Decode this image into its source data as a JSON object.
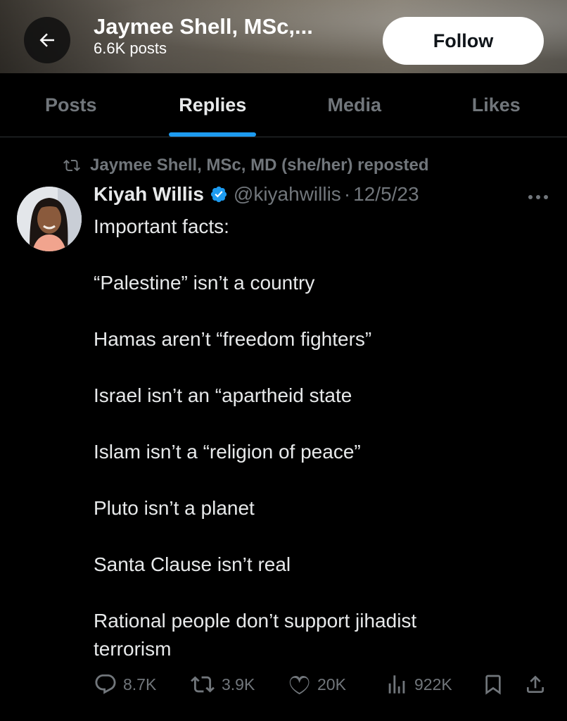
{
  "header": {
    "title": "Jaymee Shell, MSc,...",
    "subtitle": "6.6K posts",
    "follow_label": "Follow"
  },
  "tabs": [
    {
      "label": "Posts",
      "active": false
    },
    {
      "label": "Replies",
      "active": true
    },
    {
      "label": "Media",
      "active": false
    },
    {
      "label": "Likes",
      "active": false
    }
  ],
  "repost": {
    "text": "Jaymee Shell, MSc, MD (she/her) reposted",
    "icon": "repost-icon"
  },
  "tweet": {
    "author_name": "Kiyah Willis",
    "verified": true,
    "handle": "@kiyahwillis",
    "separator": "·",
    "date": "12/5/23",
    "paragraphs": [
      "Important facts:",
      "“Palestine” isn’t a country",
      "Hamas aren’t “freedom fighters”",
      "Israel isn’t an “apartheid state",
      "Islam isn’t a “religion of peace”",
      "Pluto isn’t a planet",
      "Santa Clause isn’t real",
      "Rational people don’t support jihadist terrorism"
    ],
    "stats": {
      "replies": "8.7K",
      "reposts": "3.9K",
      "likes": "20K",
      "views": "922K"
    }
  },
  "colors": {
    "accent": "#1d9bf0",
    "muted": "#71767b",
    "text": "#e7e9ea",
    "background": "#000000"
  }
}
